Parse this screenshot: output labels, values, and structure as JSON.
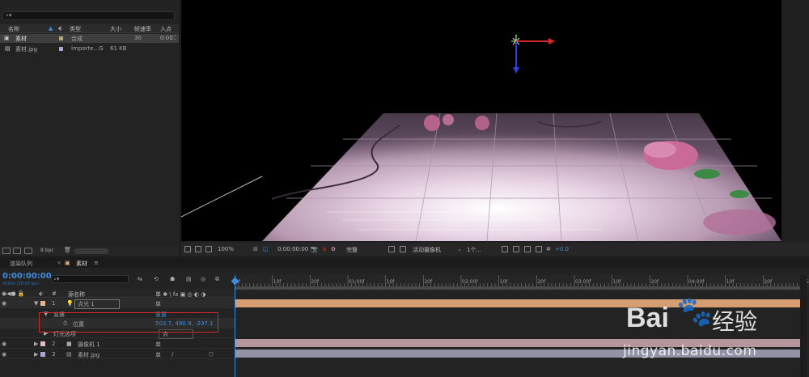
{
  "project": {
    "search_placeholder": "",
    "columns": [
      "名称",
      "类型",
      "大小",
      "帧速率",
      "入点"
    ],
    "items": [
      {
        "name": "素材",
        "type": "合成",
        "size": "",
        "fps": "30",
        "in_point": "0:00",
        "label_color": "#b8a678",
        "selected": true
      },
      {
        "name": "素材.jpg",
        "type": "Importe...G",
        "size": "61 KB",
        "fps": "",
        "in_point": "",
        "label_color": "#a7a7d8",
        "selected": false
      }
    ],
    "bpc": "8 bpc"
  },
  "viewer": {
    "zoom": "100%",
    "timecode": "0:00:00:00",
    "resolution": "完整",
    "camera": "活动摄像机",
    "views": "1个...",
    "exposure": "+0.0"
  },
  "timeline": {
    "tabs": {
      "render_queue": "渲染队列",
      "comp": "素材"
    },
    "current_time": "0:00:00:00",
    "fps_label": "00000 (30.00 fps)",
    "search_placeholder": "",
    "columns": {
      "num": "#",
      "name": "源名称",
      "parent": "单 ✱ \\ fx ▣ ◎ ◐ ◑"
    },
    "ruler": [
      "0f",
      "10f",
      "20f",
      "01:00f",
      "10f",
      "20f",
      "02:00f",
      "10f",
      "20f",
      "03:00f",
      "10f",
      "20f",
      "04:00f",
      "10f",
      "20f",
      "05:0"
    ],
    "layers": [
      {
        "num": "1",
        "name": "点光 1",
        "label_color": "#e8b48a",
        "switch": "单"
      },
      {
        "name": "变换",
        "value": "重置"
      },
      {
        "name": "位置",
        "value": "503.7, 490.9, -297.1"
      },
      {
        "name": "灯光选项",
        "value": "点"
      },
      {
        "num": "2",
        "name": "摄像机 1",
        "label_color": "#e3b8c0",
        "switch": "单"
      },
      {
        "num": "3",
        "name": "素材.jpg",
        "label_color": "#a7a7d8",
        "switch": "单"
      }
    ]
  },
  "watermark": {
    "brand": "Bai",
    "suffix": "经验",
    "url": "jingyan.baidu.com"
  }
}
